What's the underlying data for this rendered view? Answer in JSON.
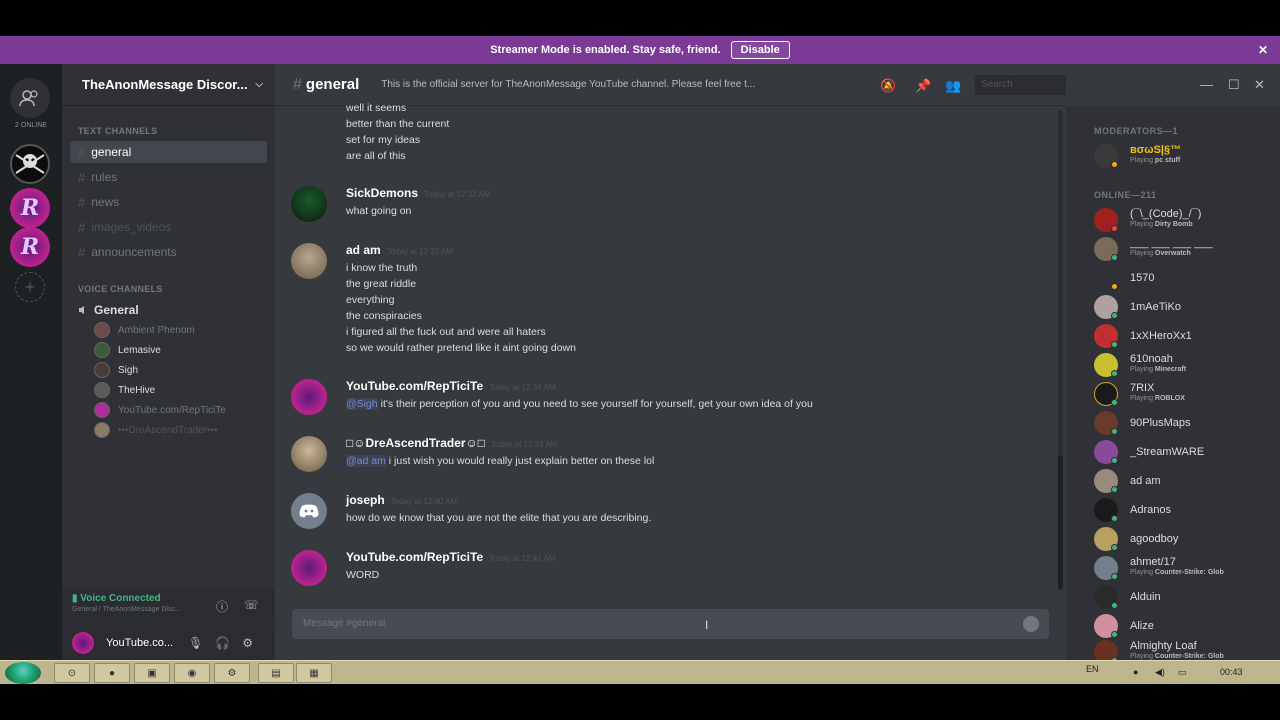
{
  "banner": {
    "text": "Streamer Mode is enabled. Stay safe, friend.",
    "button": "Disable"
  },
  "guilds": {
    "online_label": "2 ONLINE"
  },
  "server": {
    "name": "TheAnonMessage Discor..."
  },
  "channels": {
    "text_category": "TEXT CHANNELS",
    "text": [
      {
        "name": "general"
      },
      {
        "name": "rules"
      },
      {
        "name": "news"
      },
      {
        "name": "images_videos"
      },
      {
        "name": "announcements"
      }
    ],
    "voice_category": "VOICE CHANNELS",
    "voice_channel": "General",
    "voice_users": [
      "Ambient Phenom",
      "Lemasive",
      "Sigh",
      "TheHive",
      "YouTube.com/RepTiciTe",
      "•••DreAscendTrader•••"
    ]
  },
  "voice_status": {
    "title": "Voice Connected",
    "subtitle": "General / TheAnonMessage Disc..."
  },
  "user": {
    "name": "YouTube.co..."
  },
  "header": {
    "channel": "general",
    "topic": "This is the official server for TheAnonMessage YouTube channel. Please feel free t...",
    "search_placeholder": "Search"
  },
  "messages": [
    {
      "author": "",
      "timestamp": "",
      "lines": [
        "well it seems",
        "better than the current",
        "set for my ideas",
        "are all of this"
      ]
    },
    {
      "author": "SickDemons",
      "timestamp": "Today at 12:32 AM",
      "lines": [
        "what going on"
      ]
    },
    {
      "author": "ad am",
      "timestamp": "Today at 12:32 AM",
      "lines": [
        "i know the truth",
        "the great riddle",
        "everything",
        "the conspiracies",
        "i figured all the fuck out and were all haters",
        "so we would rather pretend like it aint going down"
      ]
    },
    {
      "author": "YouTube.com/RepTiciTe",
      "timestamp": "Today at 12:34 AM",
      "mention": "@Sigh",
      "lines": [
        "it's their perception of you and you need to see yourself for yourself, get your own idea of you"
      ]
    },
    {
      "author": "□☺DreAscendTrader☺□",
      "timestamp": "Today at 12:39 AM",
      "mention": "@ad am",
      "lines": [
        "i just wish you would really just explain better on these lol"
      ]
    },
    {
      "author": "joseph",
      "timestamp": "Today at 12:40 AM",
      "lines": [
        "how do we know that you are not the elite that you are describing."
      ]
    },
    {
      "author": "YouTube.com/RepTiciTe",
      "timestamp": "Today at 12:41 AM",
      "lines": [
        "WORD"
      ]
    }
  ],
  "composer": {
    "placeholder": "Message #general"
  },
  "members": {
    "mod_category": "MODERATORS—1",
    "mods": [
      {
        "name": "вσωS|§™",
        "playing": "pc stuff"
      }
    ],
    "online_category": "ONLINE—211",
    "online": [
      {
        "name": "(¯\\_(Code)_/¯)",
        "playing": "Dirty Bomb"
      },
      {
        "name": "___ ___ ___ ___",
        "playing": "Overwatch"
      },
      {
        "name": "1570",
        "playing": ""
      },
      {
        "name": "1mAeTiKo",
        "playing": ""
      },
      {
        "name": "1xXHeroXx1",
        "playing": ""
      },
      {
        "name": "610noah",
        "playing": "Minecraft"
      },
      {
        "name": "7RIX",
        "playing": "ROBLOX"
      },
      {
        "name": "90PlusMaps",
        "playing": ""
      },
      {
        "name": "_StreamWARE",
        "playing": ""
      },
      {
        "name": "ad am",
        "playing": ""
      },
      {
        "name": "Adranos",
        "playing": ""
      },
      {
        "name": "agoodboy",
        "playing": ""
      },
      {
        "name": "ahmet/17",
        "playing": "Counter-Strike: Glob"
      },
      {
        "name": "Alduin",
        "playing": ""
      },
      {
        "name": "Alize",
        "playing": ""
      },
      {
        "name": "Almighty Loaf",
        "playing": "Counter-Strike: Glob"
      }
    ],
    "playing_prefix": "Playing"
  },
  "taskbar": {
    "lang": "EN",
    "clock": "00:43"
  },
  "colors": {
    "accent": "#7289da",
    "banner": "#7a3a96",
    "online": "#43b581",
    "idle": "#faa61a",
    "dnd": "#f04747"
  }
}
